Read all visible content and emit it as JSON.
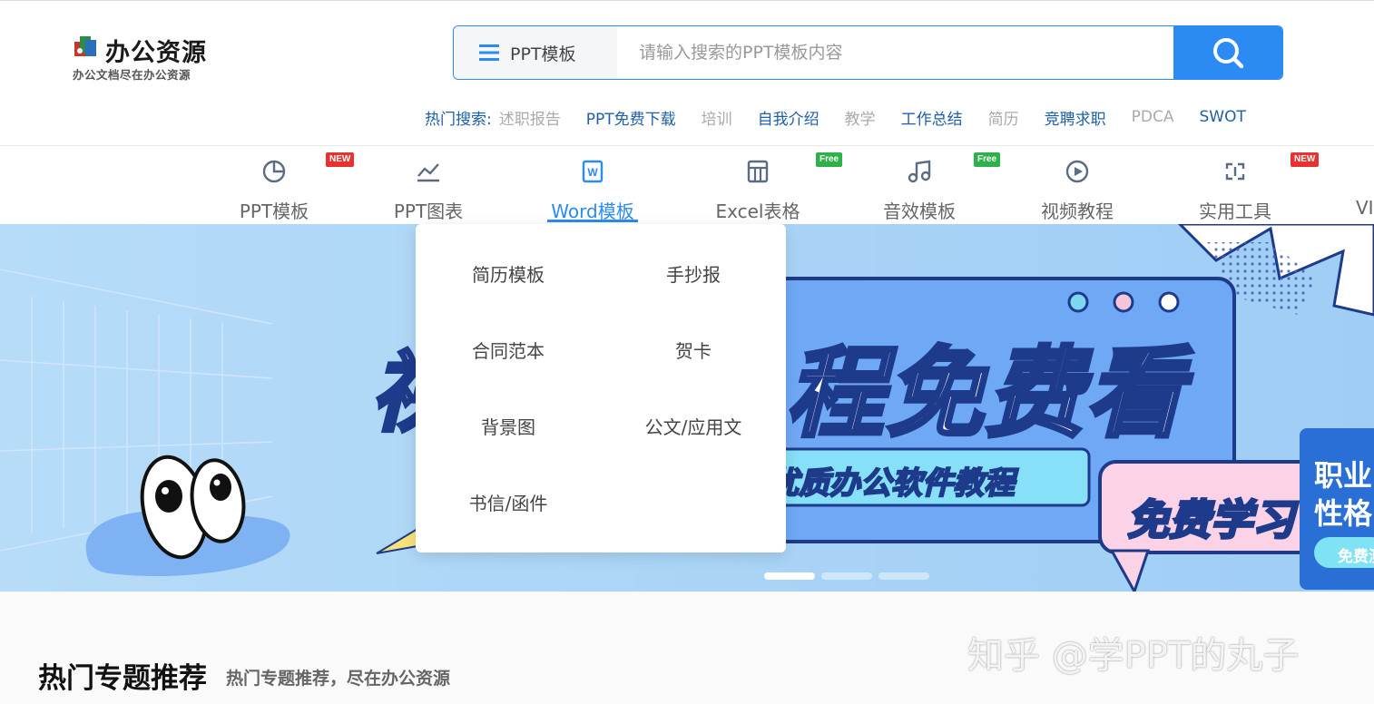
{
  "brand": {
    "name": "办公资源",
    "slogan": "办公文档尽在办公资源"
  },
  "search": {
    "category": "PPT模板",
    "placeholder": "请输入搜索的PPT模板内容",
    "value": ""
  },
  "hot_search": {
    "label": "热门搜索:",
    "items": [
      {
        "text": "述职报告",
        "style": "gray"
      },
      {
        "text": "PPT免费下载",
        "style": "blue"
      },
      {
        "text": "培训",
        "style": "gray"
      },
      {
        "text": "自我介绍",
        "style": "blue"
      },
      {
        "text": "教学",
        "style": "gray"
      },
      {
        "text": "工作总结",
        "style": "blue"
      },
      {
        "text": "简历",
        "style": "gray"
      },
      {
        "text": "竞聘求职",
        "style": "blue"
      },
      {
        "text": "PDCA",
        "style": "gray"
      },
      {
        "text": "SWOT",
        "style": "blue"
      }
    ]
  },
  "nav": {
    "items": [
      {
        "label": "PPT模板",
        "icon": "pie-chart-icon",
        "badge": "NEW"
      },
      {
        "label": "PPT图表",
        "icon": "line-chart-icon",
        "badge": ""
      },
      {
        "label": "Word模板",
        "icon": "word-doc-icon",
        "badge": "",
        "active": true
      },
      {
        "label": "Excel表格",
        "icon": "spreadsheet-icon",
        "badge": "Free"
      },
      {
        "label": "音效模板",
        "icon": "music-note-icon",
        "badge": "Free"
      },
      {
        "label": "视频教程",
        "icon": "play-circle-icon",
        "badge": ""
      },
      {
        "label": "实用工具",
        "icon": "tool-swap-icon",
        "badge": "NEW"
      },
      {
        "label": "VI",
        "icon": "",
        "badge": ""
      }
    ]
  },
  "dropdown": {
    "items": [
      "简历模板",
      "手抄报",
      "合同范本",
      "贺卡",
      "背景图",
      "公文/应用文",
      "书信/函件"
    ]
  },
  "banner": {
    "headline_left": "视",
    "headline": "程免费看",
    "sub": "优质办公软件教程",
    "bubble": "免费学习",
    "side_card": {
      "line1": "职业",
      "line2": "性格",
      "button": "免费测"
    }
  },
  "section": {
    "title": "热门专题推荐",
    "subtitle": "热门专题推荐，尽在办公资源"
  },
  "watermark": "知乎 @学PPT的丸子",
  "colors": {
    "accent": "#2b8bf2",
    "nav_link": "#1f5fa8",
    "badge_new": "#e8322f",
    "badge_free": "#2eb04a",
    "banner_bg": "#a9d4f7"
  }
}
